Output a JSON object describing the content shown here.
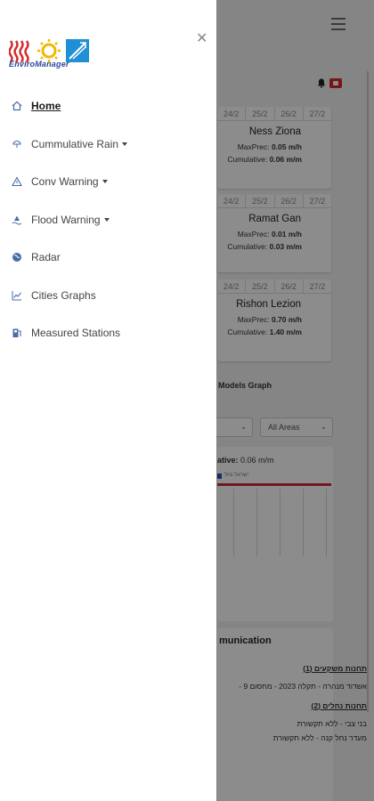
{
  "background": {
    "cities": [
      {
        "dates": [
          "24/2",
          "25/2",
          "26/2",
          "27/2"
        ],
        "name": "Ness Ziona",
        "maxprec_label": "MaxPrec:",
        "maxprec_value": "0.05 m/h",
        "cumulative_label": "Cumulative:",
        "cumulative_value": "0.06 m/m"
      },
      {
        "dates": [
          "24/2",
          "25/2",
          "26/2",
          "27/2"
        ],
        "name": "Ramat Gan",
        "maxprec_label": "MaxPrec:",
        "maxprec_value": "0.01 m/h",
        "cumulative_label": "Cumulative:",
        "cumulative_value": "0.03 m/m"
      },
      {
        "dates": [
          "24/2",
          "25/2",
          "26/2",
          "27/2"
        ],
        "name": "Rishon Lezion",
        "maxprec_label": "MaxPrec:",
        "maxprec_value": "0.70 m/h",
        "cumulative_label": "Cumulative:",
        "cumulative_value": "1.40 m/m"
      }
    ],
    "models_graph_label": "Models Graph",
    "area_select": {
      "value": "All Areas"
    },
    "graph": {
      "title_suffix": "ative:",
      "title_value": "0.06 m/m",
      "legend_text": "ישראל נחל"
    },
    "communication": {
      "title": "munication",
      "lines": [
        {
          "text": "תחנות משקעים (1)",
          "bold": true
        },
        {
          "text": "אשדוד מנהרה - תקלה 2023 - מחסום 9 -",
          "bold": false
        },
        {
          "text": "תחנות נחלים (2)",
          "bold": true
        },
        {
          "text": "בני צבי - ללא תקשורת",
          "bold": false
        },
        {
          "text": "מעדר נחל קנה - ללא תקשורת",
          "bold": false
        }
      ]
    }
  },
  "drawer": {
    "logo_text": "EnviroManager",
    "close_icon": "close-icon",
    "items": [
      {
        "label": "Home",
        "icon": "home-icon",
        "active": true,
        "dropdown": false
      },
      {
        "label": "Cummulative Rain",
        "icon": "rain-icon",
        "active": false,
        "dropdown": true
      },
      {
        "label": "Conv Warning",
        "icon": "warning-icon",
        "active": false,
        "dropdown": true
      },
      {
        "label": "Flood Warning",
        "icon": "flood-icon",
        "active": false,
        "dropdown": true
      },
      {
        "label": "Radar",
        "icon": "radar-icon",
        "active": false,
        "dropdown": false
      },
      {
        "label": "Cities Graphs",
        "icon": "chart-icon",
        "active": false,
        "dropdown": false
      },
      {
        "label": "Measured Stations",
        "icon": "station-icon",
        "active": false,
        "dropdown": false
      }
    ]
  },
  "colors": {
    "accent": "#4a6da8",
    "overlay": "#000000",
    "alert": "#d62b2b"
  }
}
